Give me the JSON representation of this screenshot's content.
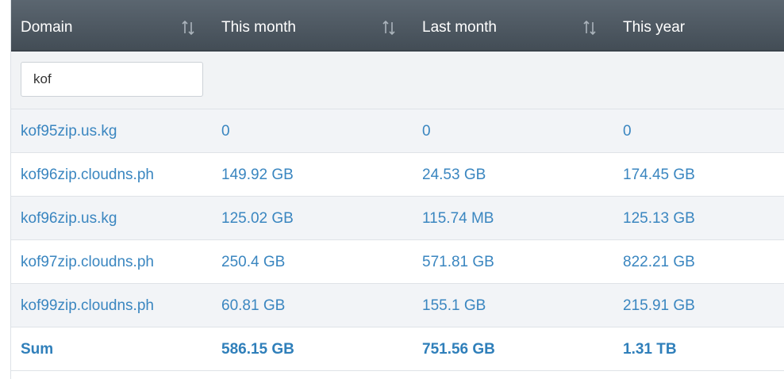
{
  "table": {
    "headers": [
      "Domain",
      "This month",
      "Last month",
      "This year"
    ],
    "filter": {
      "value": "kof"
    },
    "rows": [
      [
        "kof95zip.us.kg",
        "0",
        "0",
        "0"
      ],
      [
        "kof96zip.cloudns.ph",
        "149.92 GB",
        "24.53 GB",
        "174.45 GB"
      ],
      [
        "kof96zip.us.kg",
        "125.02 GB",
        "115.74 MB",
        "125.13 GB"
      ],
      [
        "kof97zip.cloudns.ph",
        "250.4 GB",
        "571.81 GB",
        "822.21 GB"
      ],
      [
        "kof99zip.cloudns.ph",
        "60.81 GB",
        "155.1 GB",
        "215.91 GB"
      ]
    ],
    "sum": [
      "Sum",
      "586.15 GB",
      "751.56 GB",
      "1.31 TB"
    ]
  },
  "colors": {
    "header_bg": "#4f5a64",
    "link": "#3a86c0",
    "row_alt": "#f2f4f7"
  },
  "icons": {
    "sort": "sort-arrows-icon"
  }
}
